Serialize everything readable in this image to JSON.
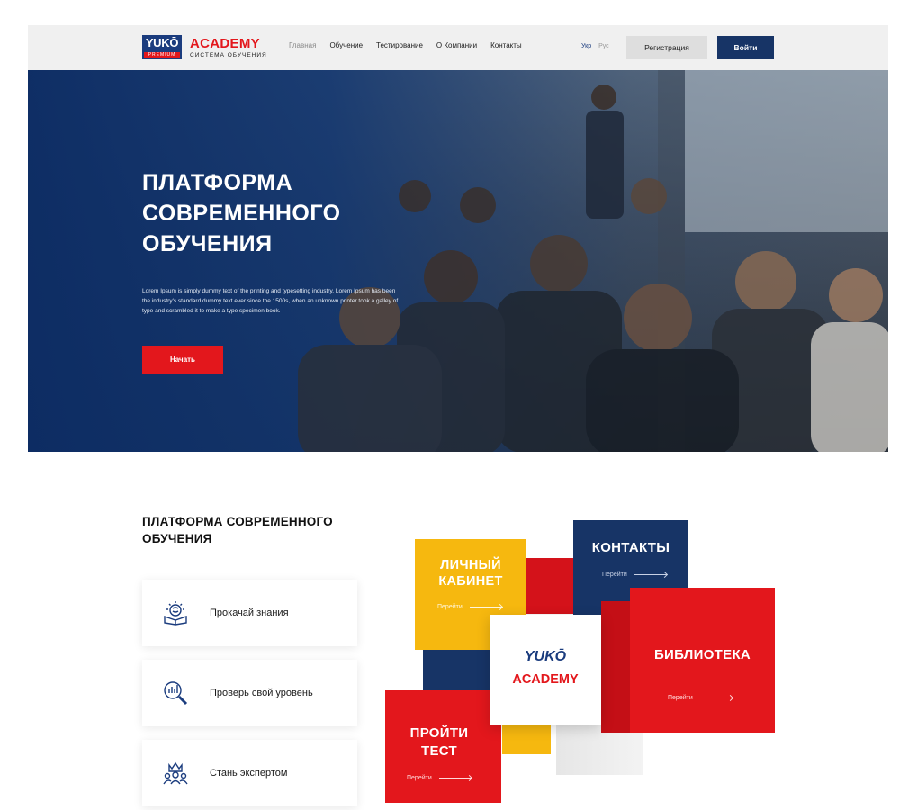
{
  "header": {
    "logo": {
      "brand": "YUKŌ",
      "tier": "PREMIUM",
      "name": "ACADEMY",
      "tagline": "СИСТЕМА ОБУЧЕНИЯ"
    },
    "nav": [
      "Главная",
      "Обучение",
      "Тестирование",
      "О Компании",
      "Контакты"
    ],
    "active_nav": "Главная",
    "languages": [
      "Укр",
      "Рус"
    ],
    "active_language": "Укр",
    "register_label": "Регистрация",
    "login_label": "Войти"
  },
  "hero": {
    "title_lines": [
      "ПЛАТФОРМА",
      "СОВРЕМЕННОГО",
      "ОБУЧЕНИЯ"
    ],
    "text": "Lorem Ipsum is simply dummy text of the printing and typesetting industry. Lorem Ipsum has been the industry's standard dummy text ever since the 1500s, when an unknown printer took a galley of type and scrambled it to make a type specimen book.",
    "start_label": "Начать"
  },
  "features": {
    "title_lines": [
      "ПЛАТФОРМА СОВРЕМЕННОГО",
      "ОБУЧЕНИЯ"
    ],
    "items": [
      {
        "label": "Прокачай знания",
        "icon": "book-brain-icon"
      },
      {
        "label": "Проверь свой уровень",
        "icon": "magnifier-chart-icon"
      },
      {
        "label": "Стань экспертом",
        "icon": "expert-crown-icon"
      }
    ]
  },
  "cubes": {
    "cabinet": {
      "lines": [
        "ЛИЧНЫЙ",
        "КАБИНЕТ"
      ],
      "link": "Перейти"
    },
    "contacts": {
      "lines": [
        "КОНТАКТЫ"
      ],
      "link": "Перейти"
    },
    "library": {
      "lines": [
        "БИБЛИОТЕКА"
      ],
      "link": "Перейти"
    },
    "test": {
      "lines": [
        "ПРОЙТИ",
        "ТЕСТ"
      ],
      "link": "Перейти"
    },
    "center": {
      "brand": "YUKŌ",
      "name": "ACADEMY"
    }
  },
  "colors": {
    "navy": "#173466",
    "red": "#e3171c",
    "yellow": "#f6b80f",
    "white": "#ffffff"
  }
}
